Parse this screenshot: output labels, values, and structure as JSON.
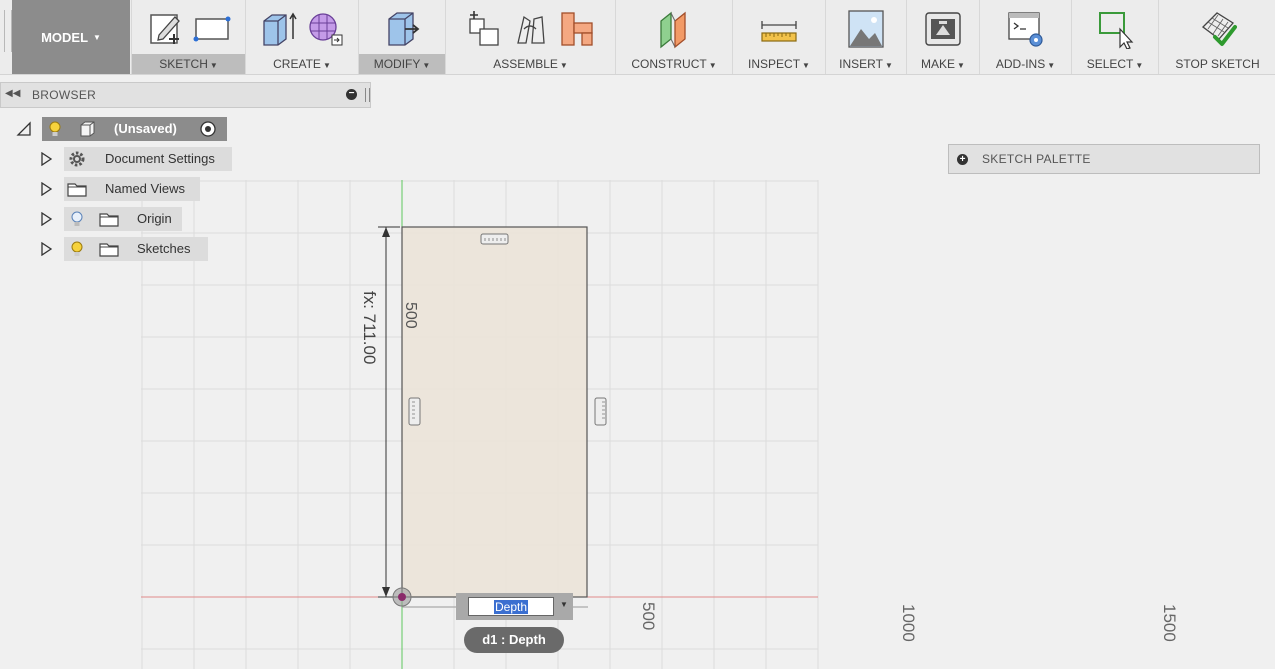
{
  "toolbar": {
    "workspace": "MODEL",
    "groups": [
      {
        "label": "SKETCH"
      },
      {
        "label": "CREATE"
      },
      {
        "label": "MODIFY"
      },
      {
        "label": "ASSEMBLE"
      },
      {
        "label": "CONSTRUCT"
      },
      {
        "label": "INSPECT"
      },
      {
        "label": "INSERT"
      },
      {
        "label": "MAKE"
      },
      {
        "label": "ADD-INS"
      },
      {
        "label": "SELECT"
      },
      {
        "label": "STOP SKETCH"
      }
    ]
  },
  "browser": {
    "title": "BROWSER",
    "root": "(Unsaved)",
    "items": [
      {
        "label": "Document Settings"
      },
      {
        "label": "Named Views"
      },
      {
        "label": "Origin"
      },
      {
        "label": "Sketches"
      }
    ]
  },
  "palette": {
    "title": "SKETCH PALETTE"
  },
  "canvas": {
    "dim_vertical": "fx: 711.00",
    "dim_inner": "500",
    "axis_labels": [
      "500",
      "1000",
      "1500"
    ]
  },
  "dimension_input": {
    "value": "Depth",
    "tooltip": "d1 : Depth"
  },
  "colors": {
    "sketch_fill": "#ebe3d8",
    "x_axis": "#e08a8a",
    "y_axis": "#5ec95e",
    "active_tab": "#bdbdbd"
  }
}
